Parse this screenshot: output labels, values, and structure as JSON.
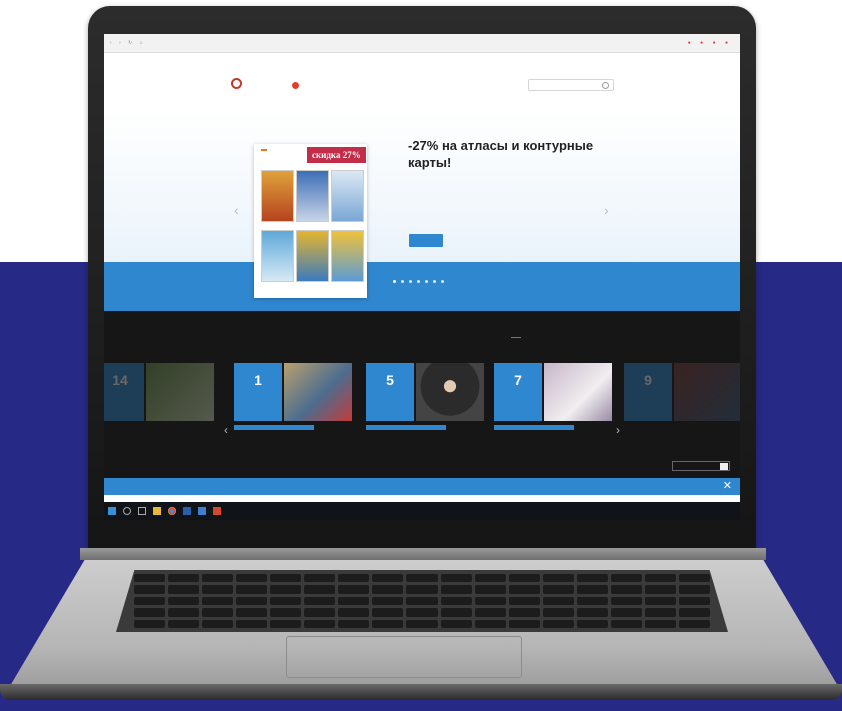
{
  "browser": {
    "nav": "‹ › ↻ ⌂",
    "address": "",
    "extensions": "● ● ● ●",
    "bookmarks": [
      "",
      "",
      "",
      "",
      "",
      ""
    ],
    "bookmarks_right": ""
  },
  "site": {
    "logo_name": "",
    "logo_brand": "",
    "nav": [
      "",
      "",
      "",
      ""
    ],
    "search_placeholder": ""
  },
  "hero": {
    "badge_logo": "",
    "badge_text": "скидка 27%",
    "title": "-27% на атласы и контурные карты!",
    "text": "",
    "button": ""
  },
  "events": {
    "title": "",
    "tabs": [
      "",
      "",
      "",
      ""
    ],
    "cards": [
      {
        "day": "14",
        "month": "",
        "tag": "",
        "title": ""
      },
      {
        "day": "1",
        "month": "",
        "tag": "",
        "title": ""
      },
      {
        "day": "5",
        "month": "",
        "tag": "",
        "title": ""
      },
      {
        "day": "7",
        "month": "",
        "tag": "",
        "title": ""
      },
      {
        "day": "9",
        "month": "",
        "tag": "",
        "title": ""
      }
    ],
    "button": ""
  },
  "cookie": {
    "text": "",
    "close": "✕"
  },
  "taskbar": {
    "time": "",
    "date": ""
  },
  "colors": {
    "brand_blue": "#2f87cf",
    "background_band": "#262a86",
    "badge": "#c22d4a",
    "events_bg": "#161616"
  }
}
